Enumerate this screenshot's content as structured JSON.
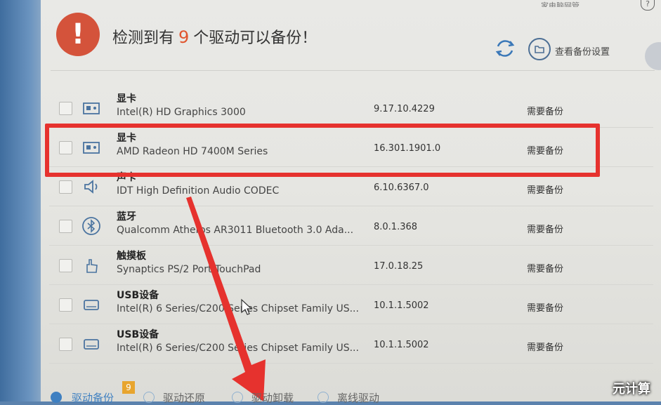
{
  "header": {
    "title_prefix": "检测到有",
    "count": "9",
    "title_suffix": "个驱动可以备份！",
    "settings_label": "查看备份设置",
    "top_partial": "家电脑网管"
  },
  "drivers": [
    {
      "category": "显卡",
      "name": "Intel(R) HD Graphics 3000",
      "version": "9.17.10.4229",
      "status": "需要备份",
      "icon": "display-card-icon"
    },
    {
      "category": "显卡",
      "name": "AMD Radeon HD 7400M Series",
      "version": "16.301.1901.0",
      "status": "需要备份",
      "icon": "display-card-icon"
    },
    {
      "category": "声卡",
      "name": "IDT High Definition Audio CODEC",
      "version": "6.10.6367.0",
      "status": "需要备份",
      "icon": "speaker-icon"
    },
    {
      "category": "蓝牙",
      "name": "Qualcomm Atheros AR3011 Bluetooth 3.0 Ada...",
      "version": "8.0.1.368",
      "status": "需要备份",
      "icon": "bluetooth-icon"
    },
    {
      "category": "触摸板",
      "name": "Synaptics PS/2 Port TouchPad",
      "version": "17.0.18.25",
      "status": "需要备份",
      "icon": "touchpad-icon"
    },
    {
      "category": "USB设备",
      "name": "Intel(R) 6 Series/C200 Series Chipset Family US...",
      "version": "10.1.1.5002",
      "status": "需要备份",
      "icon": "usb-drive-icon"
    },
    {
      "category": "USB设备",
      "name": "Intel(R) 6 Series/C200 Series Chipset Family US...",
      "version": "10.1.1.5002",
      "status": "需要备份",
      "icon": "usb-drive-icon"
    }
  ],
  "bottom_tabs": [
    {
      "label": "驱动备份",
      "active": true
    },
    {
      "label": "驱动还原",
      "active": false
    },
    {
      "label": "驱动卸载",
      "active": false
    },
    {
      "label": "离线驱动",
      "active": false
    }
  ],
  "badge": "9",
  "watermark": "元计算",
  "colors": {
    "highlight": "#e6322e",
    "accent": "#3e7fc1",
    "warning": "#d4533b"
  }
}
